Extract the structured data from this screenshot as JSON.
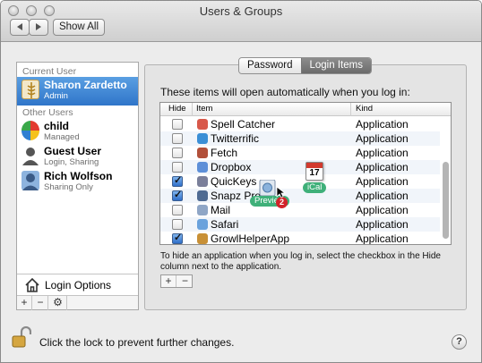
{
  "window": {
    "title": "Users & Groups"
  },
  "toolbar": {
    "show_all": "Show All"
  },
  "sidebar": {
    "current_user_header": "Current User",
    "other_users_header": "Other Users",
    "users": [
      {
        "name": "Sharon Zardetto",
        "sub": "Admin",
        "selected": true
      },
      {
        "name": "child",
        "sub": "Managed"
      },
      {
        "name": "Guest User",
        "sub": "Login, Sharing"
      },
      {
        "name": "Rich Wolfson",
        "sub": "Sharing Only"
      }
    ],
    "login_options": "Login Options",
    "buttons": {
      "add": "+",
      "remove": "−",
      "gear": "⚙"
    }
  },
  "tabs": [
    {
      "label": "Password",
      "active": false
    },
    {
      "label": "Login Items",
      "active": true
    }
  ],
  "main": {
    "heading": "These items will open automatically when you log in:",
    "columns": {
      "hide": "Hide",
      "item": "Item",
      "kind": "Kind"
    },
    "items": [
      {
        "name": "Spell Catcher",
        "kind": "Application",
        "hide": false,
        "icon_color": "#d8584a"
      },
      {
        "name": "Twitterrific",
        "kind": "Application",
        "hide": false,
        "icon_color": "#3b8fd6"
      },
      {
        "name": "Fetch",
        "kind": "Application",
        "hide": false,
        "icon_color": "#b2503a"
      },
      {
        "name": "Dropbox",
        "kind": "Application",
        "hide": false,
        "icon_color": "#5d8fd8"
      },
      {
        "name": "QuicKeys",
        "kind": "Application",
        "hide": true,
        "icon_color": "#7a7f9a"
      },
      {
        "name": "Snapz Pro X",
        "kind": "Application",
        "hide": true,
        "icon_color": "#4e6a92"
      },
      {
        "name": "Mail",
        "kind": "Application",
        "hide": false,
        "icon_color": "#8fa6c6"
      },
      {
        "name": "Safari",
        "kind": "Application",
        "hide": false,
        "icon_color": "#6aa2dc"
      },
      {
        "name": "GrowlHelperApp",
        "kind": "Application",
        "hide": true,
        "icon_color": "#c89036"
      }
    ],
    "hint": "To hide an application when you log in, select the checkbox in the Hide column next to the application.",
    "add_label": "+",
    "remove_label": "−"
  },
  "drag": {
    "preview_label": "Preview",
    "ical_label": "iCal",
    "ical_date": "17",
    "badge_count": "2"
  },
  "footer": {
    "lock_text": "Click the lock to prevent further changes.",
    "help": "?"
  },
  "colors": {
    "selection": "#2f75c9",
    "badge": "#d2232a",
    "tag_green": "#3fb079"
  }
}
